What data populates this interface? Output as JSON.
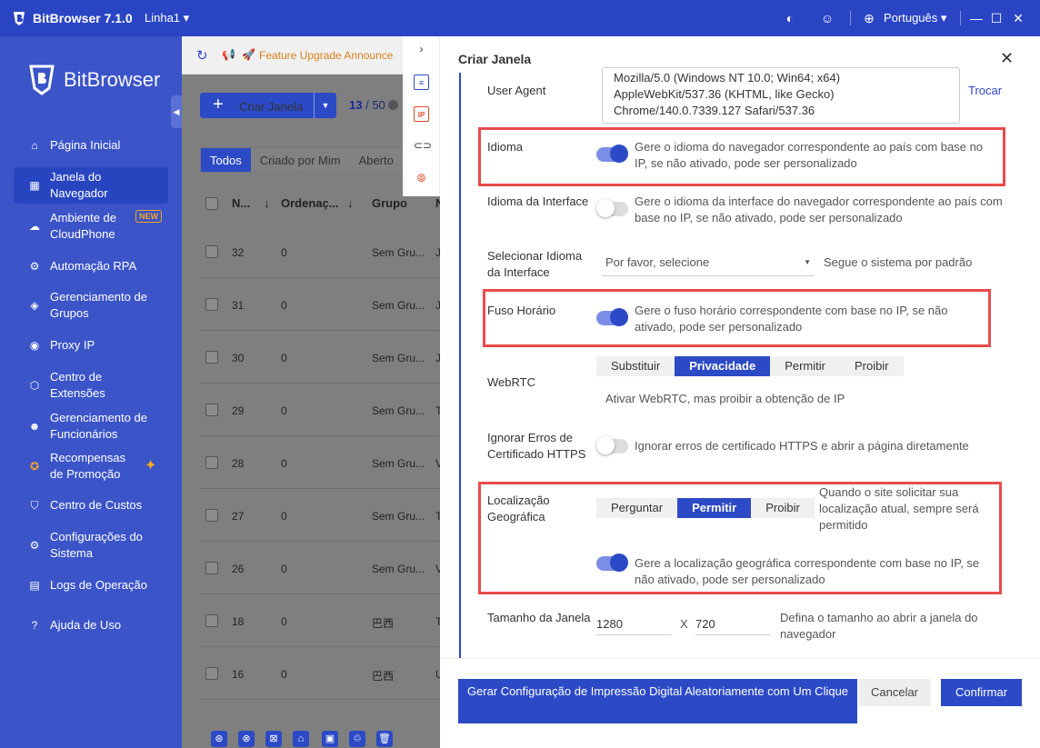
{
  "app": {
    "title": "BitBrowser 7.1.0",
    "profile": "Linha1",
    "language": "Português"
  },
  "sidebar": {
    "brand": "BitBrowser",
    "items": [
      {
        "label": "Página Inicial",
        "icon": "home-icon"
      },
      {
        "label": "Janela do Navegador",
        "icon": "grid-icon",
        "active": true
      },
      {
        "label": "Ambiente de CloudPhone",
        "icon": "cloud-icon",
        "badge": "NEW"
      },
      {
        "label": "Automação RPA",
        "icon": "robot-icon"
      },
      {
        "label": "Gerenciamento de Grupos",
        "icon": "layers-icon"
      },
      {
        "label": "Proxy IP",
        "icon": "location-icon"
      },
      {
        "label": "Centro de Extensões",
        "icon": "cube-icon"
      },
      {
        "label": "Gerenciamento de Funcionários",
        "icon": "users-icon"
      },
      {
        "label": "Recompensas de Promoção",
        "icon": "reward-icon"
      },
      {
        "label": "Centro de Custos",
        "icon": "shield-icon"
      },
      {
        "label": "Configurações do Sistema",
        "icon": "gear-icon"
      },
      {
        "label": "Logs de Operação",
        "icon": "log-icon"
      },
      {
        "label": "Ajuda de Uso",
        "icon": "help-icon"
      }
    ]
  },
  "main": {
    "announcement": "Feature Upgrade Announce",
    "create_button": "Criar Janela",
    "count_current": "13",
    "count_total": "/ 50",
    "tabs": [
      "Todos",
      "Criado por Mim",
      "Aberto"
    ],
    "columns": [
      "N...",
      "Ordenaç...",
      "Grupo",
      "N"
    ],
    "rows": [
      {
        "n": "32",
        "ord": "0",
        "group": "Sem Gru...",
        "x": "J"
      },
      {
        "n": "31",
        "ord": "0",
        "group": "Sem Gru...",
        "x": "J"
      },
      {
        "n": "30",
        "ord": "0",
        "group": "Sem Gru...",
        "x": "J"
      },
      {
        "n": "29",
        "ord": "0",
        "group": "Sem Gru...",
        "x": "T"
      },
      {
        "n": "28",
        "ord": "0",
        "group": "Sem Gru...",
        "x": "V"
      },
      {
        "n": "27",
        "ord": "0",
        "group": "Sem Gru...",
        "x": "T"
      },
      {
        "n": "26",
        "ord": "0",
        "group": "Sem Gru...",
        "x": "V"
      },
      {
        "n": "18",
        "ord": "0",
        "group": "巴西",
        "x": "T"
      },
      {
        "n": "16",
        "ord": "0",
        "group": "巴西",
        "x": "U"
      }
    ]
  },
  "modal": {
    "title": "Criar Janela",
    "user_agent": {
      "label": "User Agent",
      "value_lines": [
        "Mozilla/5.0 (Windows NT 10.0; Win64; x64)",
        "AppleWebKit/537.36 (KHTML, like Gecko)",
        "Chrome/140.0.7339.127 Safari/537.36"
      ],
      "action": "Trocar"
    },
    "idioma": {
      "label": "Idioma",
      "desc": "Gere o idioma do navegador correspondente ao país com base no IP, se não ativado, pode ser personalizado"
    },
    "idioma_interface": {
      "label": "Idioma da Interface",
      "desc": "Gere o idioma da interface do navegador correspondente ao país com base no IP, se não ativado, pode ser personalizado"
    },
    "selecionar_idioma": {
      "label": "Selecionar Idioma da Interface",
      "placeholder": "Por favor, selecione",
      "hint": "Segue o sistema por padrão"
    },
    "fuso": {
      "label": "Fuso Horário",
      "desc": "Gere o fuso horário correspondente com base no IP, se não ativado, pode ser personalizado"
    },
    "webrtc": {
      "label": "WebRTC",
      "options": [
        "Substituir",
        "Privacidade",
        "Permitir",
        "Proibir"
      ],
      "desc": "Ativar WebRTC, mas proibir a obtenção de IP"
    },
    "cert": {
      "label": "Ignorar Erros de Certificado HTTPS",
      "desc": "Ignorar erros de certificado HTTPS e abrir a página diretamente"
    },
    "geo": {
      "label": "Localização Geográfica",
      "options": [
        "Perguntar",
        "Permitir",
        "Proibir"
      ],
      "hint": "Quando o site solicitar sua localização atual, sempre será permitido",
      "desc": "Gere a localização geográfica correspondente com base no IP, se não ativado, pode ser personalizado"
    },
    "window_size": {
      "label": "Tamanho da Janela",
      "width": "1280",
      "x": "X",
      "height": "720",
      "hint": "Defina o tamanho ao abrir a janela do navegador"
    },
    "buttons": {
      "generate": "Gerar Configuração de Impressão Digital Aleatoriamente com Um Clique",
      "cancel": "Cancelar",
      "confirm": "Confirmar"
    }
  }
}
